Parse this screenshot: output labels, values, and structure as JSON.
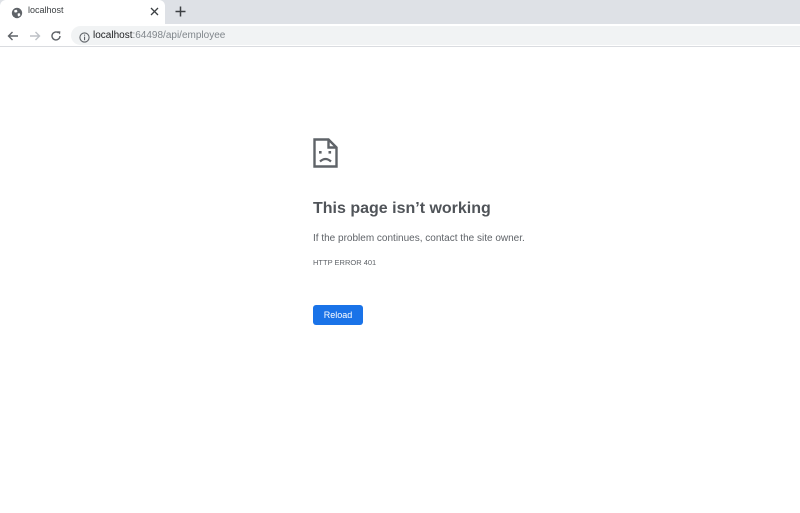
{
  "browser": {
    "tab": {
      "title": "localhost",
      "favicon_icon": "globe-icon",
      "close_icon": "close-icon"
    },
    "new_tab_icon": "plus-icon",
    "nav": {
      "back_icon": "arrow-left-icon",
      "forward_icon": "arrow-right-icon",
      "reload_icon": "reload-icon"
    },
    "address_bar": {
      "info_icon": "info-icon",
      "host": "localhost",
      "path": ":64498/api/employee"
    }
  },
  "error_page": {
    "icon": "sad-page-icon",
    "headline": "This page isn’t working",
    "message": "If the problem continues, contact the site owner.",
    "error_code": "HTTP ERROR 401",
    "reload_label": "Reload"
  },
  "colors": {
    "tabstrip": "#dee1e6",
    "omnibox": "#f1f3f4",
    "button": "#1a73e8",
    "text": "#5f6368"
  }
}
